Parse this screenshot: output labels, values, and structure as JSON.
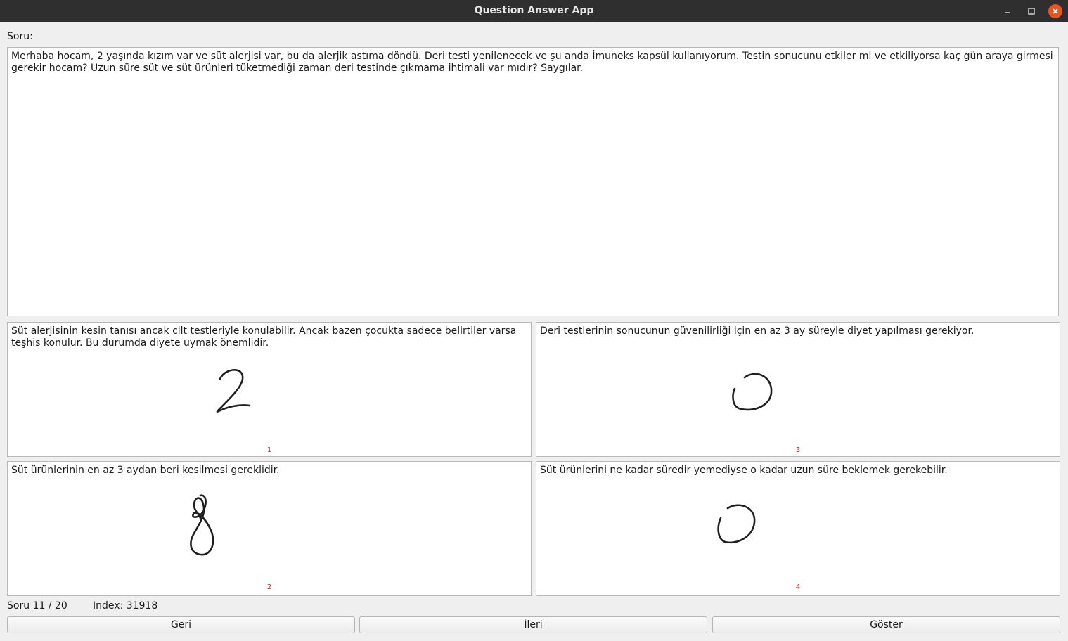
{
  "window": {
    "title": "Question Answer App"
  },
  "question": {
    "label": "Soru:",
    "text": "Merhaba hocam, 2 yaşında kızım var ve süt alerjisi var, bu da alerjik astıma döndü. Deri testi yenilenecek ve şu anda İmuneks kapsül kullanıyorum. Testin sonucunu etkiler mi ve etkiliyorsa kaç gün araya girmesi gerekir hocam? Uzun süre süt ve süt ürünleri tüketmediği zaman deri testinde çıkmama ihtimali var mıdır? Saygılar."
  },
  "answers": [
    {
      "number": "1",
      "text": "Süt alerjisinin kesin tanısı ancak cilt testleriyle konulabilir. Ancak bazen çocukta sadece belirtiler varsa teşhis konulur. Bu durumda diyete uymak önemlidir.",
      "handwritten_score": 2
    },
    {
      "number": "2",
      "text": "Süt ürünlerinin en az 3 aydan beri kesilmesi gereklidir.",
      "handwritten_score": 8
    },
    {
      "number": "3",
      "text": "Deri testlerinin sonucunun güvenilirliği için en az 3 ay süreyle diyet yapılması gerekiyor.",
      "handwritten_score": 0
    },
    {
      "number": "4",
      "text": "Süt ürünlerini ne kadar süredir yemediyse o kadar uzun süre beklemek gerekebilir.",
      "handwritten_score": 0
    }
  ],
  "status": {
    "progress": "Soru 11 / 20",
    "index": "Index: 31918"
  },
  "buttons": {
    "back": "Geri",
    "next": "İleri",
    "show": "Göster"
  },
  "colors": {
    "titlebar": "#2f2f2f",
    "close_button": "#e95420",
    "answer_number": "#cc2222"
  }
}
